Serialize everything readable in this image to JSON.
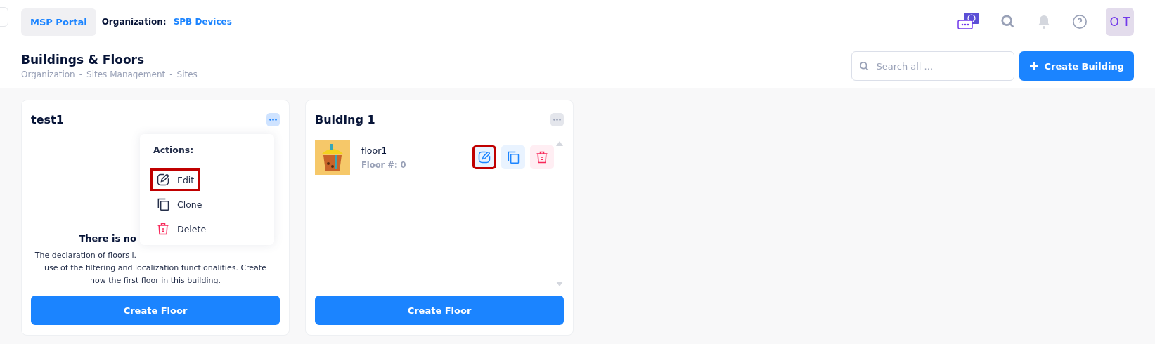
{
  "header": {
    "portal": "MSP Portal",
    "org_label": "Organization:",
    "org_name": "SPB Devices",
    "avatar": "O T"
  },
  "page": {
    "title": "Buildings & Floors",
    "breadcrumbs": [
      "Organization",
      "Sites Management",
      "Sites"
    ],
    "breadcrumb_separator": "-",
    "search": {
      "placeholder": "Search all ..."
    },
    "create_button": "Create Building"
  },
  "buildings": [
    {
      "name": "test1",
      "menu_open": true,
      "empty": {
        "title": "There is no",
        "line_1": "The declaration of floors i.",
        "rest": "use of the filtering and localization functionalities. Create now the first floor in this building."
      },
      "button": "Create Floor"
    },
    {
      "name": "Buiding 1",
      "menu_open": false,
      "floors": [
        {
          "name": "floor1",
          "number": "Floor #: 0",
          "actions": [
            {
              "kind": "edit",
              "highlighted": true
            },
            {
              "kind": "clone",
              "highlighted": false
            },
            {
              "kind": "delete",
              "highlighted": false
            }
          ]
        }
      ],
      "button": "Create Floor"
    }
  ],
  "menu": {
    "title": "Actions:",
    "items": [
      {
        "kind": "edit",
        "label": "Edit",
        "highlighted": true
      },
      {
        "kind": "clone",
        "label": "Clone",
        "highlighted": false
      },
      {
        "kind": "delete",
        "label": "Delete",
        "highlighted": false
      }
    ]
  }
}
